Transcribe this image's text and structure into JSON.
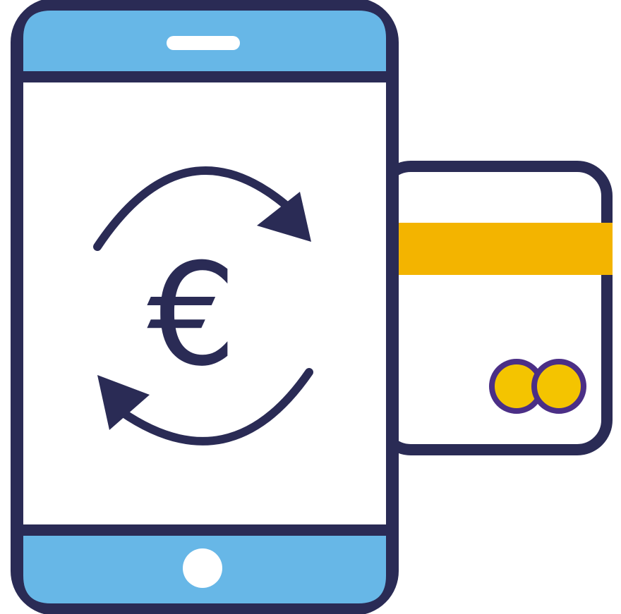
{
  "illustration": {
    "currency_symbol": "€",
    "icons": {
      "phone": "smartphone-icon",
      "exchange": "currency-exchange-icon",
      "card": "credit-card-icon",
      "card_logo": "card-brand-logo-icon"
    },
    "colors": {
      "outline": "#2a2b55",
      "phone_band": "#67b7e7",
      "screen": "#ffffff",
      "card_stripe": "#f3b400",
      "card_logo_fill": "#f4c400",
      "card_logo_outline": "#4b2f86",
      "background": "#ffffff"
    }
  }
}
